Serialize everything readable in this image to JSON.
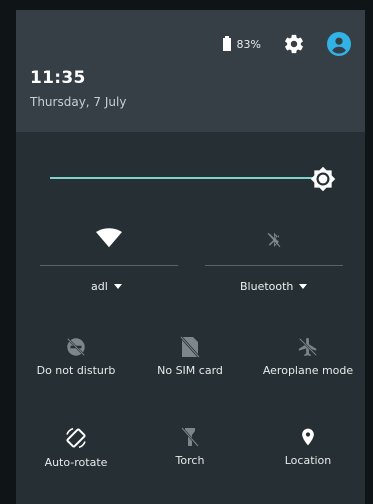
{
  "status": {
    "battery_percent": "83%",
    "time": "11:35",
    "date": "Thursday, 7 July"
  },
  "brightness": {
    "level": 0.93
  },
  "tiles_large": [
    {
      "label": "adl",
      "icon": "wifi-icon",
      "state": "on"
    },
    {
      "label": "Bluetooth",
      "icon": "bluetooth-icon",
      "state": "off"
    }
  ],
  "tiles_small": [
    {
      "label": "Do not disturb",
      "icon": "do-not-disturb-icon",
      "state": "off"
    },
    {
      "label": "No SIM card",
      "icon": "no-sim-icon",
      "state": "off"
    },
    {
      "label": "Aeroplane mode",
      "icon": "airplane-icon",
      "state": "off"
    },
    {
      "label": "Auto-rotate",
      "icon": "auto-rotate-icon",
      "state": "on"
    },
    {
      "label": "Torch",
      "icon": "torch-icon",
      "state": "off"
    },
    {
      "label": "Location",
      "icon": "location-icon",
      "state": "on"
    }
  ],
  "colors": {
    "accent": "#7fd0cf",
    "avatar": "#31b3e8",
    "active_icon": "#ffffff",
    "inactive_icon": "#7d878b"
  }
}
